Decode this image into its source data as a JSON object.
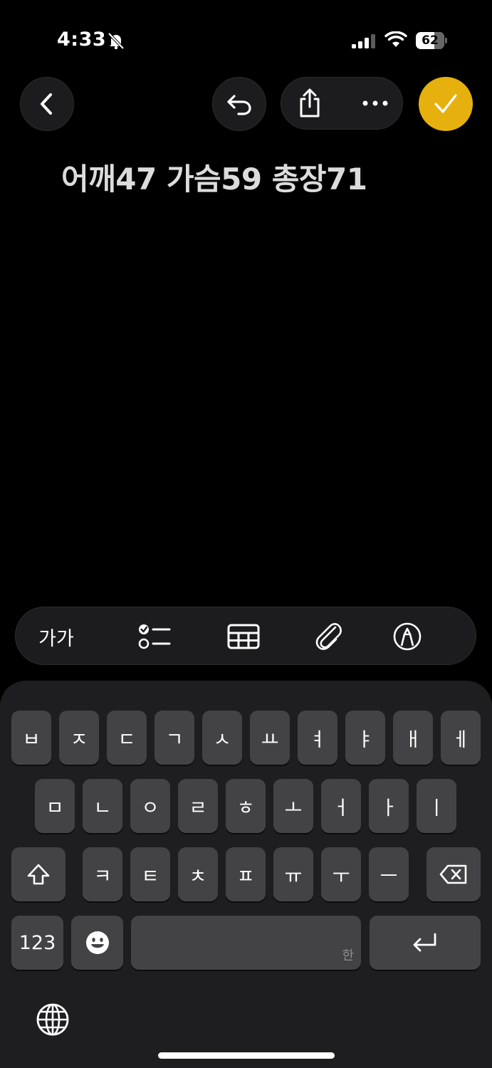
{
  "status_bar": {
    "time": "4:33",
    "battery": "62",
    "icons": [
      "bell-slash-icon",
      "cellular-signal-icon",
      "wifi-icon",
      "battery-icon"
    ]
  },
  "toolbar": {
    "back_icon": "chevron-left-icon",
    "undo_icon": "undo-icon",
    "share_icon": "share-icon",
    "more_icon": "ellipsis-icon",
    "done_icon": "checkmark-icon",
    "accent_color": "#e6b10e"
  },
  "note": {
    "text": "어깨47 가슴59 총장71"
  },
  "format_bar": {
    "text_style_label": "가가",
    "icons": [
      "text-style-icon",
      "checklist-icon",
      "table-icon",
      "paperclip-icon",
      "markup-icon",
      "more-format-icon"
    ]
  },
  "keyboard": {
    "row1": [
      "ㅂ",
      "ㅈ",
      "ㄷ",
      "ㄱ",
      "ㅅ",
      "ㅛ",
      "ㅕ",
      "ㅑ",
      "ㅐ",
      "ㅔ"
    ],
    "row2": [
      "ㅁ",
      "ㄴ",
      "ㅇ",
      "ㄹ",
      "ㅎ",
      "ㅗ",
      "ㅓ",
      "ㅏ",
      "ㅣ"
    ],
    "row3": [
      "ㅋ",
      "ㅌ",
      "ㅊ",
      "ㅍ",
      "ㅠ",
      "ㅜ",
      "ㅡ"
    ],
    "numbers_label": "123",
    "space_hint": "한",
    "icons": [
      "shift-icon",
      "delete-icon",
      "emoji-icon",
      "return-icon",
      "globe-icon"
    ]
  }
}
